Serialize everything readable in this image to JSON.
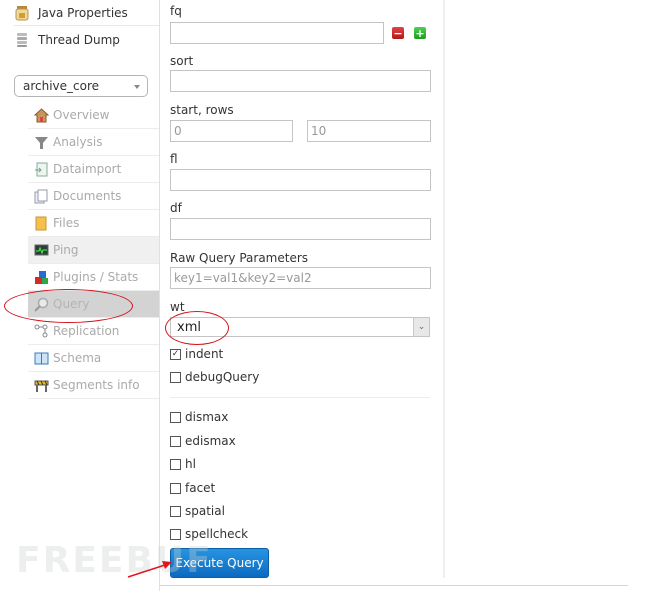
{
  "sidebar": {
    "top_items": [
      {
        "label": "Java Properties",
        "icon": "java-properties-icon"
      },
      {
        "label": "Thread Dump",
        "icon": "thread-dump-icon"
      }
    ],
    "core_selector": {
      "value": "archive_core"
    },
    "core_menu": [
      {
        "label": "Overview",
        "icon": "house-icon"
      },
      {
        "label": "Analysis",
        "icon": "funnel-icon"
      },
      {
        "label": "Dataimport",
        "icon": "dataimport-icon"
      },
      {
        "label": "Documents",
        "icon": "documents-icon"
      },
      {
        "label": "Files",
        "icon": "folder-icon"
      },
      {
        "label": "Ping",
        "icon": "ping-monitor-icon"
      },
      {
        "label": "Plugins / Stats",
        "icon": "plugins-blocks-icon"
      },
      {
        "label": "Query",
        "icon": "magnifier-icon",
        "active": true
      },
      {
        "label": "Replication",
        "icon": "replication-icon"
      },
      {
        "label": "Schema",
        "icon": "book-icon"
      },
      {
        "label": "Segments info",
        "icon": "segments-barrier-icon"
      }
    ]
  },
  "form": {
    "fq": {
      "label": "fq",
      "value": ""
    },
    "sort": {
      "label": "sort",
      "value": ""
    },
    "start_rows": {
      "label": "start, rows",
      "start_placeholder": "0",
      "rows_placeholder": "10"
    },
    "fl": {
      "label": "fl",
      "value": ""
    },
    "df": {
      "label": "df",
      "value": ""
    },
    "raw": {
      "label": "Raw Query Parameters",
      "placeholder": "key1=val1&key2=val2"
    },
    "wt": {
      "label": "wt",
      "value": "xml"
    },
    "checkboxes_top": [
      {
        "label": "indent",
        "checked": true
      },
      {
        "label": "debugQuery",
        "checked": false
      }
    ],
    "checkboxes_bottom": [
      {
        "label": "dismax",
        "checked": false
      },
      {
        "label": "edismax",
        "checked": false
      },
      {
        "label": "hl",
        "checked": false
      },
      {
        "label": "facet",
        "checked": false
      },
      {
        "label": "spatial",
        "checked": false
      },
      {
        "label": "spellcheck",
        "checked": false
      }
    ],
    "execute_label": "Execute Query"
  },
  "watermark": "FREEBUF",
  "colors": {
    "annotation": "#d4141c",
    "button_blue": "#1a7fd4",
    "active_item": "#d3d3d3"
  }
}
